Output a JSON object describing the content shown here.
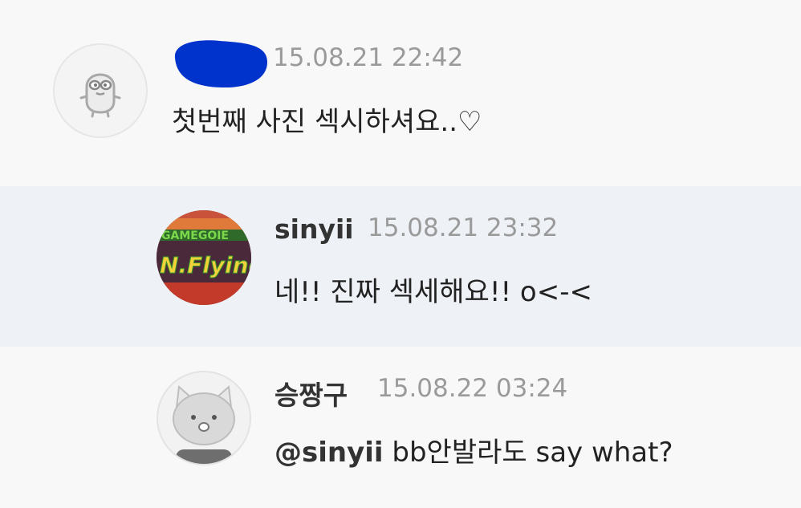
{
  "comments": [
    {
      "author": "",
      "time": "15.08.21 22:42",
      "text": "첫번째 사진 섹시하셔요..♡",
      "avatar_icon": "blob-character-icon",
      "author_redacted": true,
      "redaction_color": "#0033cc"
    },
    {
      "author": "sinyii",
      "time": "15.08.21 23:32",
      "text": "네!! 진짜 섹세해요!! o<-<",
      "avatar_icon": "photo-avatar",
      "highlighted": true
    },
    {
      "author": "승짱구",
      "time": "15.08.22 03:24",
      "mention": "@sinyii",
      "text": " bb안발라도 say what?",
      "avatar_icon": "cat-character-icon"
    }
  ],
  "colors": {
    "background": "#f8f8f8",
    "highlight_row": "#eef1f5",
    "time_text": "#9a9a9a",
    "body_text": "#222222"
  }
}
